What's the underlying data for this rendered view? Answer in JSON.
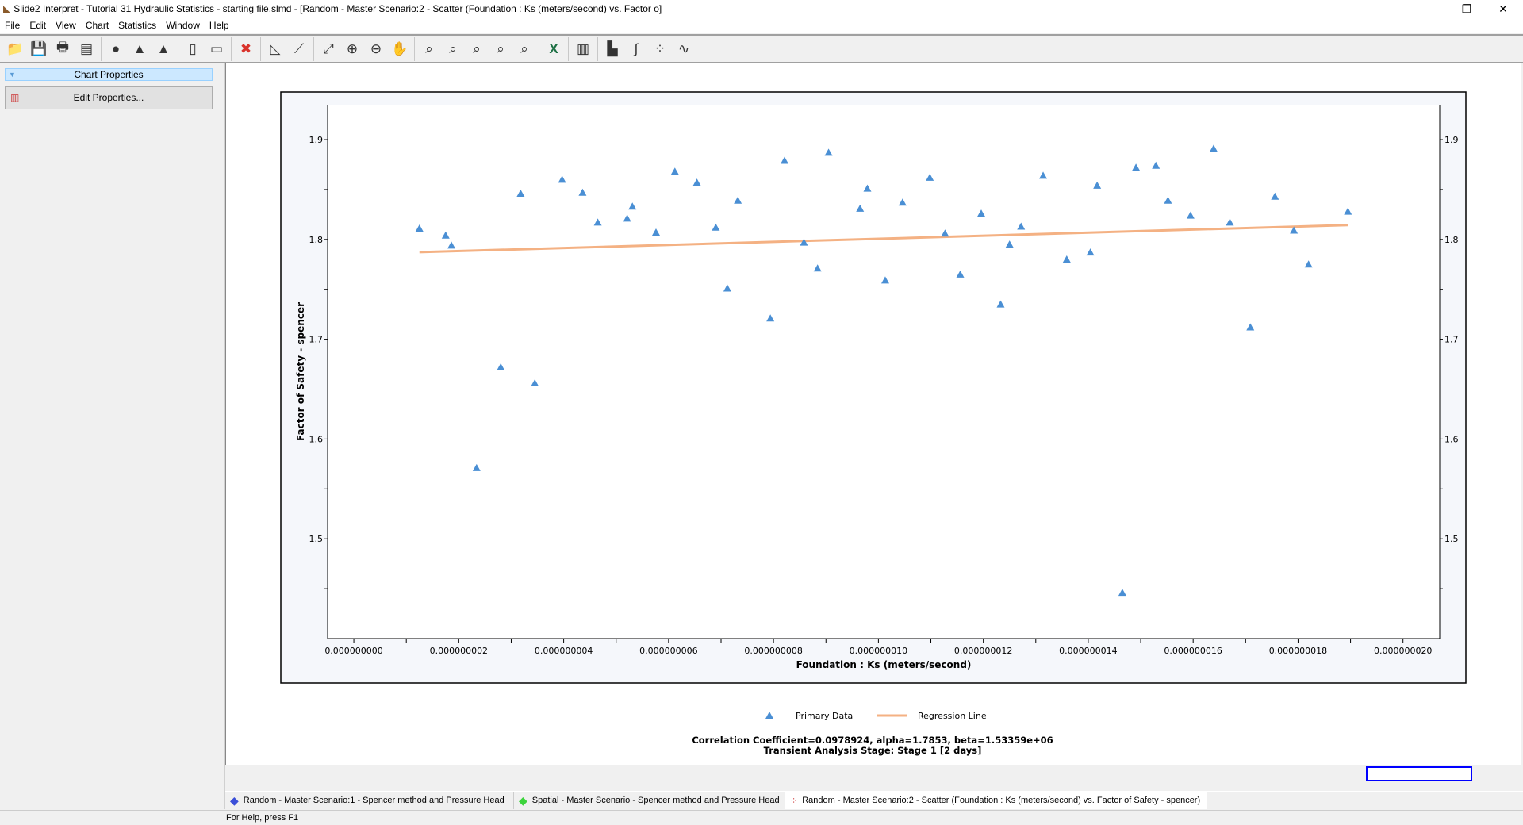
{
  "window": {
    "title": "Slide2 Interpret - Tutorial 31 Hydraulic Statistics - starting file.slmd - [Random - Master Scenario:2 - Scatter (Foundation : Ks (meters/second) vs. Factor o]",
    "minimize": "–",
    "restore": "❐",
    "close": "✕"
  },
  "menu": [
    "File",
    "Edit",
    "View",
    "Chart",
    "Statistics",
    "Window",
    "Help"
  ],
  "toolbar": [
    {
      "icon": "open-folder-icon",
      "glyph": "📁"
    },
    {
      "icon": "save-icon",
      "glyph": "💾"
    },
    {
      "icon": "print-icon",
      "glyph": "🖶"
    },
    {
      "icon": "print-preview-icon",
      "glyph": "▤"
    },
    {
      "sep": true
    },
    {
      "icon": "sphere-icon",
      "glyph": "●"
    },
    {
      "icon": "chart-disabled-icon",
      "glyph": "▲"
    },
    {
      "icon": "chart-disabled2-icon",
      "glyph": "▲"
    },
    {
      "sep": true
    },
    {
      "icon": "tile-vertical-icon",
      "glyph": "▯"
    },
    {
      "icon": "tile-horizontal-icon",
      "glyph": "▭"
    },
    {
      "sep": true
    },
    {
      "icon": "close-red-icon",
      "glyph": "✖"
    },
    {
      "sep": true
    },
    {
      "icon": "slope-icon",
      "glyph": "◺"
    },
    {
      "icon": "line-tool-icon",
      "glyph": "⟋"
    },
    {
      "sep": true
    },
    {
      "icon": "zoom-extents-icon",
      "glyph": "⤢"
    },
    {
      "icon": "zoom-in-icon",
      "glyph": "⊕"
    },
    {
      "icon": "zoom-out-icon",
      "glyph": "⊖"
    },
    {
      "icon": "pan-icon",
      "glyph": "✋"
    },
    {
      "sep": true
    },
    {
      "icon": "zoom-window-icon",
      "glyph": "⌕"
    },
    {
      "icon": "zoom-step-icon",
      "glyph": "⌕"
    },
    {
      "icon": "zoom-previous-icon",
      "glyph": "⌕"
    },
    {
      "icon": "zoom-last-icon",
      "glyph": "⌕"
    },
    {
      "icon": "zoom-lock-icon",
      "glyph": "⌕"
    },
    {
      "sep": true
    },
    {
      "icon": "excel-icon",
      "glyph": "X"
    },
    {
      "sep": true
    },
    {
      "icon": "chart-properties-icon",
      "glyph": "▥"
    },
    {
      "sep": true
    },
    {
      "icon": "histogram-icon",
      "glyph": "▙"
    },
    {
      "icon": "cumulative-icon",
      "glyph": "∫"
    },
    {
      "icon": "scatter-icon",
      "glyph": "⁘"
    },
    {
      "icon": "sampler-icon",
      "glyph": "∿"
    }
  ],
  "sidebar": {
    "header": "Chart Properties",
    "edit_button": "Edit Properties..."
  },
  "colors": {
    "points": "#4a8fd4",
    "regression": "#f4b183",
    "selection_box": "#0000ff"
  },
  "chart_data": {
    "type": "scatter",
    "xlabel": "Foundation : Ks (meters/second)",
    "ylabel": "Factor of Safety - spencer",
    "xlim": [
      -5e-10,
      2.07e-08
    ],
    "ylim": [
      1.4,
      1.935
    ],
    "xticks": [
      0,
      2e-09,
      4e-09,
      6e-09,
      8e-09,
      1e-08,
      1.2e-08,
      1.4e-08,
      1.6e-08,
      1.8e-08,
      2e-08
    ],
    "xtick_labels": [
      "0.000000000",
      "0.000000002",
      "0.000000004",
      "0.000000006",
      "0.000000008",
      "0.000000010",
      "0.000000012",
      "0.000000014",
      "0.000000016",
      "0.000000018",
      "0.000000020"
    ],
    "yticks": [
      1.5,
      1.6,
      1.7,
      1.8,
      1.9
    ],
    "ytick_labels": [
      "1.5",
      "1.6",
      "1.7",
      "1.8",
      "1.9"
    ],
    "grid": false,
    "legend_position": "bottom",
    "series": [
      {
        "name": "Primary Data",
        "marker": "triangle",
        "points": [
          [
            1.25e-09,
            1.811
          ],
          [
            1.75e-09,
            1.804
          ],
          [
            1.86e-09,
            1.794
          ],
          [
            2.34e-09,
            1.571
          ],
          [
            2.8e-09,
            1.672
          ],
          [
            3.18e-09,
            1.846
          ],
          [
            3.45e-09,
            1.656
          ],
          [
            3.97e-09,
            1.86
          ],
          [
            4.36e-09,
            1.847
          ],
          [
            4.65e-09,
            1.817
          ],
          [
            5.21e-09,
            1.821
          ],
          [
            5.31e-09,
            1.833
          ],
          [
            5.76e-09,
            1.807
          ],
          [
            6.12e-09,
            1.868
          ],
          [
            6.54e-09,
            1.857
          ],
          [
            6.9e-09,
            1.812
          ],
          [
            7.12e-09,
            1.751
          ],
          [
            7.32e-09,
            1.839
          ],
          [
            7.94e-09,
            1.721
          ],
          [
            8.21e-09,
            1.879
          ],
          [
            8.58e-09,
            1.797
          ],
          [
            8.84e-09,
            1.771
          ],
          [
            9.05e-09,
            1.887
          ],
          [
            9.65e-09,
            1.831
          ],
          [
            9.79e-09,
            1.851
          ],
          [
            1.013e-08,
            1.759
          ],
          [
            1.046e-08,
            1.837
          ],
          [
            1.098e-08,
            1.862
          ],
          [
            1.127e-08,
            1.806
          ],
          [
            1.156e-08,
            1.765
          ],
          [
            1.196e-08,
            1.826
          ],
          [
            1.233e-08,
            1.735
          ],
          [
            1.25e-08,
            1.795
          ],
          [
            1.272e-08,
            1.813
          ],
          [
            1.314e-08,
            1.864
          ],
          [
            1.359e-08,
            1.78
          ],
          [
            1.404e-08,
            1.787
          ],
          [
            1.417e-08,
            1.854
          ],
          [
            1.465e-08,
            1.446
          ],
          [
            1.491e-08,
            1.872
          ],
          [
            1.529e-08,
            1.874
          ],
          [
            1.552e-08,
            1.839
          ],
          [
            1.595e-08,
            1.824
          ],
          [
            1.639e-08,
            1.891
          ],
          [
            1.67e-08,
            1.817
          ],
          [
            1.709e-08,
            1.712
          ],
          [
            1.756e-08,
            1.843
          ],
          [
            1.792e-08,
            1.809
          ],
          [
            1.82e-08,
            1.775
          ],
          [
            1.895e-08,
            1.828
          ]
        ]
      },
      {
        "name": "Regression Line",
        "type": "line",
        "points": [
          [
            1.25e-09,
            1.7872
          ],
          [
            1.895e-08,
            1.8144
          ]
        ]
      }
    ],
    "annotations": [
      "Correlation Coefficient=0.0978924, alpha=1.7853, beta=1.53359e+06",
      "Transient Analysis Stage: Stage 1 [2 days]"
    ]
  },
  "tabs": [
    {
      "label": "Random - Master Scenario:1 - Spencer method and Pressure Head",
      "icon": "blue-diamond-icon",
      "color": "#3b4fd8"
    },
    {
      "label": "Spatial - Master Scenario - Spencer method and Pressure Head",
      "icon": "green-diamond-icon",
      "color": "#3cd43c"
    },
    {
      "label": "Random - Master Scenario:2 - Scatter (Foundation : Ks (meters/second) vs. Factor of Safety - spencer)",
      "icon": "scatter-icon",
      "active": true
    }
  ],
  "status": "For Help, press F1"
}
